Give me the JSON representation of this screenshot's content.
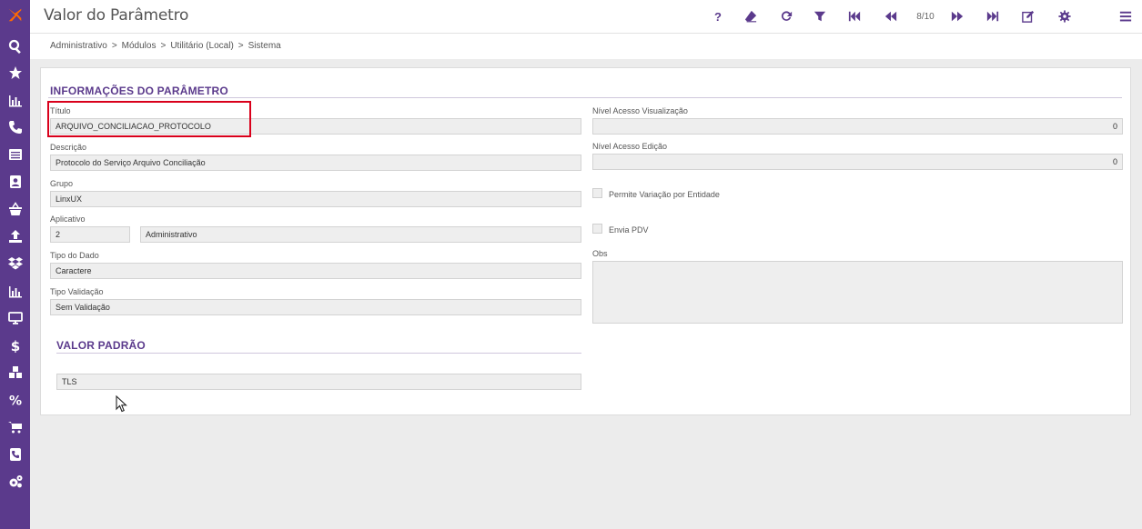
{
  "header": {
    "title": "Valor do Parâmetro",
    "counter": "8/10",
    "help_label": "?"
  },
  "colors": {
    "accent": "#5b3a8c",
    "logo_orange": "#ff6a00",
    "highlight": "#d9001b"
  },
  "sidebar": {
    "items": [
      {
        "icon": "search-icon"
      },
      {
        "icon": "star-icon"
      },
      {
        "icon": "bar-chart-icon"
      },
      {
        "icon": "phone-icon"
      },
      {
        "icon": "list-icon"
      },
      {
        "icon": "contact-card-icon"
      },
      {
        "icon": "basket-icon"
      },
      {
        "icon": "upload-icon"
      },
      {
        "icon": "dropbox-icon"
      },
      {
        "icon": "bar-chart-icon"
      },
      {
        "icon": "monitor-icon"
      },
      {
        "icon": "dollar-icon"
      },
      {
        "icon": "cubes-icon"
      },
      {
        "icon": "percent-icon"
      },
      {
        "icon": "cart-icon"
      },
      {
        "icon": "phone-book-icon"
      },
      {
        "icon": "gears-icon"
      }
    ]
  },
  "breadcrumb": [
    "Administrativo",
    "Módulos",
    "Utilitário (Local)",
    "Sistema"
  ],
  "breadcrumb_sep": ">",
  "section_info": {
    "title": "INFORMAÇÕES DO PARÂMETRO"
  },
  "section_default": {
    "title": "VALOR PADRÃO"
  },
  "fields": {
    "titulo": {
      "label": "Título",
      "value": "ARQUIVO_CONCILIACAO_PROTOCOLO"
    },
    "descricao": {
      "label": "Descrição",
      "value": "Protocolo do Serviço Arquivo Conciliação"
    },
    "grupo": {
      "label": "Grupo",
      "value": "LinxUX"
    },
    "aplicativo": {
      "label": "Aplicativo",
      "code": "2",
      "name": "Administrativo"
    },
    "tipo_dado": {
      "label": "Tipo do Dado",
      "value": "Caractere"
    },
    "tipo_validacao": {
      "label": "Tipo Validação",
      "value": "Sem Validação"
    },
    "nivel_visualizacao": {
      "label": "Nível Acesso Visualização",
      "value": "0"
    },
    "nivel_edicao": {
      "label": "Nível Acesso Edição",
      "value": "0"
    },
    "permite_variacao": {
      "label": "Permite Variação por Entidade",
      "checked": false
    },
    "envia_pdv": {
      "label": "Envia PDV",
      "checked": false
    },
    "obs": {
      "label": "Obs",
      "value": ""
    },
    "valor_padrao": {
      "value": "TLS"
    }
  }
}
